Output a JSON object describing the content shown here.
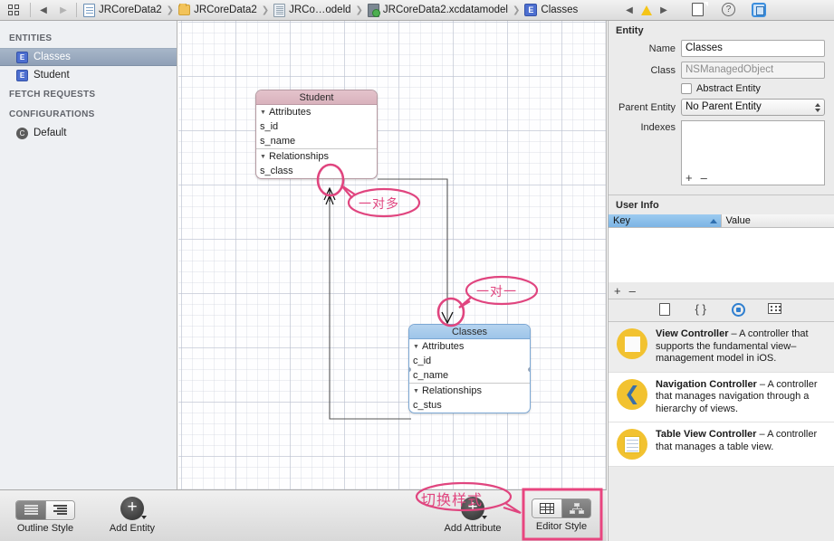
{
  "window": {
    "title": "JRCoreData2.xcdatamodeld — Xcode Core Data Model Editor"
  },
  "topbar": {
    "jump_bar_icon": "grid-jump-bar-icon",
    "back_arrow": "◀",
    "forward_arrow": "▶",
    "breadcrumbs": [
      {
        "label": "JRCoreData2",
        "icon": "project-document-icon"
      },
      {
        "label": "JRCoreData2",
        "icon": "folder-icon"
      },
      {
        "label": "JRCo…odeld",
        "icon": "datamodel-group-icon"
      },
      {
        "label": "JRCoreData2.xcdatamodel",
        "icon": "datamodel-version-icon"
      },
      {
        "label": "Classes",
        "icon": "entity-icon"
      }
    ],
    "issue_prev": "◀",
    "issue_warning_icon": "warning-triangle-icon",
    "issue_next": "▶",
    "inspector_tabs": [
      {
        "name": "file-inspector-icon",
        "selected": false
      },
      {
        "name": "quick-help-inspector-icon",
        "selected": false
      },
      {
        "name": "entity-inspector-icon",
        "selected": true
      }
    ]
  },
  "sidebar": {
    "sections": [
      {
        "title": "ENTITIES",
        "items": [
          {
            "label": "Classes",
            "icon": "entity-icon",
            "selected": true
          },
          {
            "label": "Student",
            "icon": "entity-icon",
            "selected": false
          }
        ]
      },
      {
        "title": "FETCH REQUESTS",
        "items": []
      },
      {
        "title": "CONFIGURATIONS",
        "items": [
          {
            "label": "Default",
            "icon": "configuration-icon",
            "selected": false
          }
        ]
      }
    ]
  },
  "canvas": {
    "entities": [
      {
        "name": "Student",
        "header_color": "#d9b2bd",
        "selected": false,
        "groups": [
          {
            "label": "Attributes",
            "members": [
              "s_id",
              "s_name"
            ]
          },
          {
            "label": "Relationships",
            "members": [
              "s_class"
            ]
          }
        ]
      },
      {
        "name": "Classes",
        "header_color": "#9ec5e9",
        "selected": true,
        "groups": [
          {
            "label": "Attributes",
            "members": [
              "c_id",
              "c_name"
            ]
          },
          {
            "label": "Relationships",
            "members": [
              "c_stus"
            ]
          }
        ]
      }
    ],
    "relationships": [
      {
        "from": "Classes.c_stus",
        "to": "Student",
        "cardinality": "to-many",
        "marker": "crow-foot-arrow"
      },
      {
        "from": "Student.s_class",
        "to": "Classes",
        "cardinality": "to-one",
        "marker": "single-arrow"
      }
    ],
    "annotations": [
      {
        "text": "一对多",
        "meaning": "one-to-many",
        "color": "#e0457f"
      },
      {
        "text": "一对一",
        "meaning": "one-to-one",
        "color": "#e0457f"
      },
      {
        "text": "切换样式",
        "meaning": "switch style",
        "color": "#e0457f"
      }
    ]
  },
  "bottom_toolbar": {
    "outline_style": {
      "label": "Outline Style",
      "options": [
        "flat-list-icon",
        "hierarchical-list-icon"
      ],
      "selected_index": 0
    },
    "add_entity": {
      "label": "Add Entity",
      "icon": "plus-circle-icon"
    },
    "add_attribute": {
      "label": "Add Attribute",
      "icon": "plus-circle-icon"
    },
    "editor_style": {
      "label": "Editor Style",
      "options": [
        "table-style-icon",
        "graph-style-icon"
      ],
      "selected_index": 1,
      "highlighted": true
    }
  },
  "inspector": {
    "entity_section": {
      "title": "Entity",
      "fields": [
        {
          "label": "Name",
          "value": "Classes",
          "type": "text"
        },
        {
          "label": "Class",
          "value": "NSManagedObject",
          "type": "text",
          "readonly": true
        },
        {
          "label": "Abstract Entity",
          "value": "",
          "type": "checkbox",
          "checked": false
        },
        {
          "label": "Parent Entity",
          "value": "No Parent Entity",
          "type": "select"
        },
        {
          "label": "Indexes",
          "value": "",
          "type": "listbox"
        }
      ],
      "listbox_add": "+",
      "listbox_remove": "–"
    },
    "user_info": {
      "title": "User Info",
      "columns": [
        "Key",
        "Value"
      ],
      "sorted_column": "Key",
      "sort_direction": "asc",
      "rows": [],
      "add": "+",
      "remove": "–"
    },
    "library": {
      "tabs": [
        {
          "name": "file-template-library-icon",
          "selected": false
        },
        {
          "name": "code-snippet-library-icon",
          "selected": false
        },
        {
          "name": "object-library-icon",
          "selected": true
        },
        {
          "name": "media-library-icon",
          "selected": false
        }
      ],
      "items": [
        {
          "title": "View Controller",
          "dash": "–",
          "description": "A controller that supports the fundamental view–management model in iOS.",
          "icon": "view-controller-icon",
          "selected": true
        },
        {
          "title": "Navigation Controller",
          "dash": "–",
          "description": "A controller that manages navigation through a hierarchy of views.",
          "icon": "navigation-controller-icon",
          "selected": false
        },
        {
          "title": "Table View Controller",
          "dash": "–",
          "description": "A controller that manages a table view.",
          "icon": "table-view-controller-icon",
          "selected": false
        }
      ]
    },
    "status_bar": {
      "grid_icon": "library-grid-icon",
      "filter_icon": "filter-circle-icon",
      "search_placeholder": ""
    }
  }
}
